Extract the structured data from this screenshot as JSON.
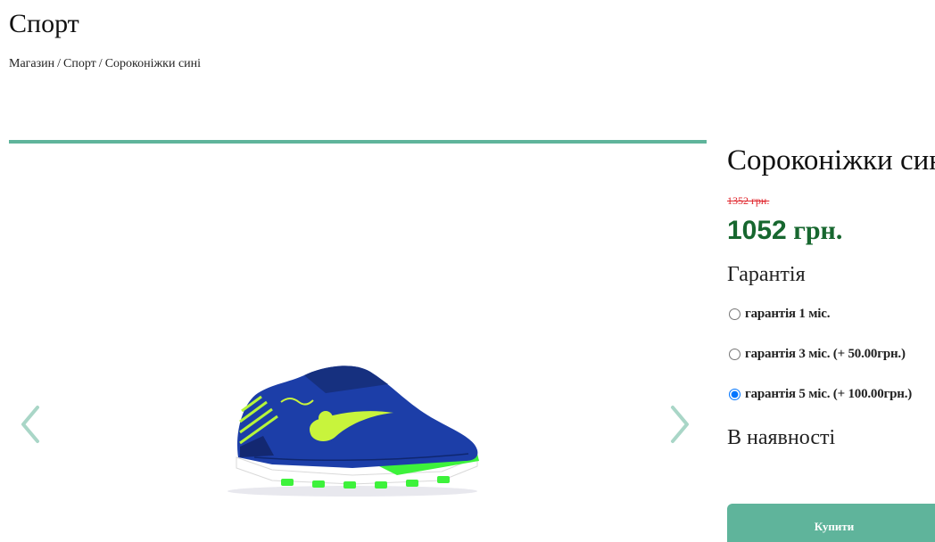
{
  "category": {
    "title": "Спорт"
  },
  "breadcrumb": {
    "items": [
      "Магазин",
      "Спорт",
      "Сороконіжки сині"
    ],
    "separator": "/"
  },
  "product": {
    "title": "Сороконіжки сині",
    "old_price": "1352 грн.",
    "new_price_number": "1052",
    "new_price_currency": "грн.",
    "warranty_title": "Гарантія",
    "warranty_options": [
      {
        "label": "гарантія 1 міс.",
        "selected": false
      },
      {
        "label": "гарантія 3 міс. (+ 50.00грн.)",
        "selected": false
      },
      {
        "label": "гарантія 5 міс. (+ 100.00грн.)",
        "selected": true
      }
    ],
    "availability": "В наявності",
    "buy_label": "Купити"
  },
  "gallery": {
    "image_icon": "shoe-image",
    "prev_icon": "chevron-left-icon",
    "next_icon": "chevron-right-icon"
  },
  "colors": {
    "accent": "#5fb49b",
    "price_green": "#17672f",
    "old_price_red": "#e0262d"
  }
}
